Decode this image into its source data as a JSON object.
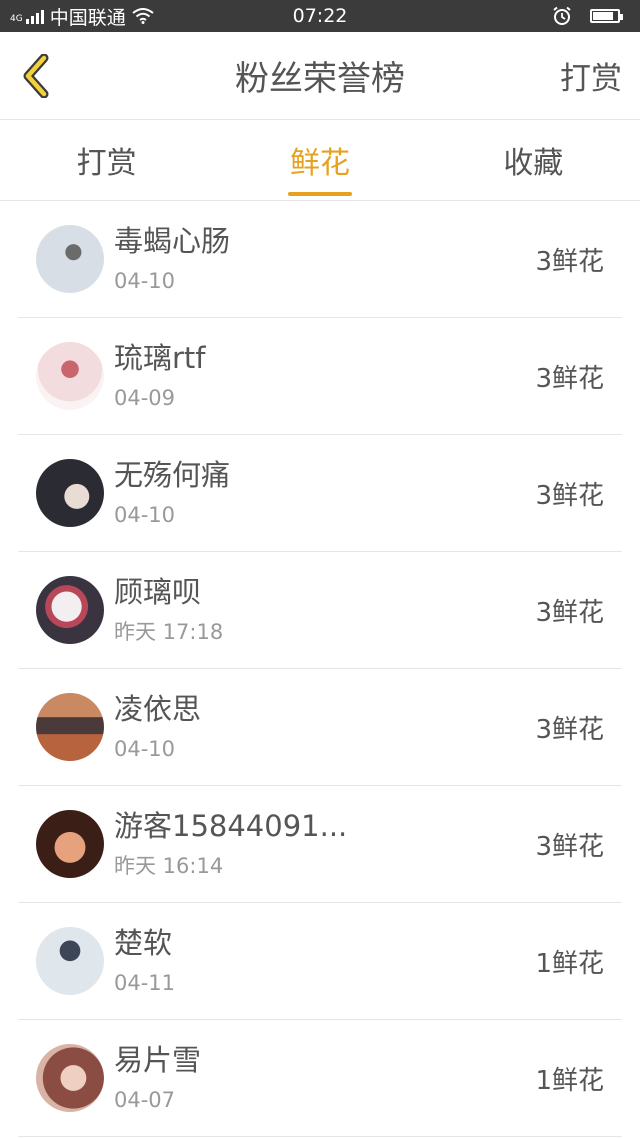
{
  "status_bar": {
    "network_small": "4G",
    "carrier": "中国联通",
    "time": "07:22"
  },
  "header": {
    "title": "粉丝荣誉榜",
    "action_label": "打赏"
  },
  "tabs": [
    {
      "label": "打赏",
      "active": false
    },
    {
      "label": "鲜花",
      "active": true
    },
    {
      "label": "收藏",
      "active": false
    }
  ],
  "fans": [
    {
      "name": "毒蝎心肠",
      "time": "04-10",
      "gift": "3鲜花"
    },
    {
      "name": "琉璃rtf",
      "time": "04-09",
      "gift": "3鲜花"
    },
    {
      "name": "无殇何痛",
      "time": "04-10",
      "gift": "3鲜花"
    },
    {
      "name": "顾璃呗",
      "time": "昨天 17:18",
      "gift": "3鲜花"
    },
    {
      "name": "凌依思",
      "time": "04-10",
      "gift": "3鲜花"
    },
    {
      "name": "游客15844091...",
      "time": "昨天 16:14",
      "gift": "3鲜花"
    },
    {
      "name": "楚软",
      "time": "04-11",
      "gift": "1鲜花"
    },
    {
      "name": "易片雪",
      "time": "04-07",
      "gift": "1鲜花"
    }
  ],
  "colors": {
    "accent": "#e6a11f",
    "status_bar_bg": "#3b3b3b",
    "text": "#555555",
    "subtext": "#999999",
    "divider": "#e6e6e6"
  },
  "battery_level": 0.85,
  "icons": {
    "back": "chevron-left-icon",
    "wifi": "wifi-icon",
    "alarm": "alarm-icon",
    "battery": "battery-icon",
    "signal": "signal-icon"
  }
}
